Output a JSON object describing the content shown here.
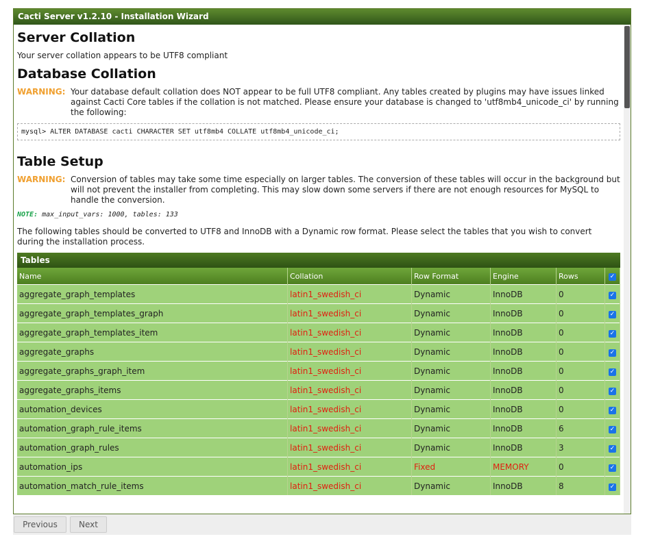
{
  "window": {
    "title": "Cacti Server v1.2.10 - Installation Wizard"
  },
  "server_collation": {
    "heading": "Server Collation",
    "text": "Your server collation appears to be UTF8 compliant"
  },
  "database_collation": {
    "heading": "Database Collation",
    "warning_label": "WARNING:",
    "warning_text": "Your database default collation does NOT appear to be full UTF8 compliant. Any tables created by plugins may have issues linked against Cacti Core tables if the collation is not matched. Please ensure your database is changed to 'utf8mb4_unicode_ci' by running the following:",
    "command": "mysql> ALTER DATABASE cacti CHARACTER SET utf8mb4 COLLATE utf8mb4_unicode_ci;"
  },
  "table_setup": {
    "heading": "Table Setup",
    "warning_label": "WARNING:",
    "warning_text": "Conversion of tables may take some time especially on larger tables. The conversion of these tables will occur in the background but will not prevent the installer from completing. This may slow down some servers if there are not enough resources for MySQL to handle the conversion.",
    "note_label": "NOTE:",
    "note_text": "max_input_vars: 1000, tables: 133",
    "description": "The following tables should be converted to UTF8 and InnoDB with a Dynamic row format. Please select the tables that you wish to convert during the installation process."
  },
  "tables": {
    "title": "Tables",
    "columns": [
      "Name",
      "Collation",
      "Row Format",
      "Engine",
      "Rows"
    ],
    "rows": [
      {
        "name": "aggregate_graph_templates",
        "collation": "latin1_swedish_ci",
        "row_format": "Dynamic",
        "engine": "InnoDB",
        "rows": "0"
      },
      {
        "name": "aggregate_graph_templates_graph",
        "collation": "latin1_swedish_ci",
        "row_format": "Dynamic",
        "engine": "InnoDB",
        "rows": "0"
      },
      {
        "name": "aggregate_graph_templates_item",
        "collation": "latin1_swedish_ci",
        "row_format": "Dynamic",
        "engine": "InnoDB",
        "rows": "0"
      },
      {
        "name": "aggregate_graphs",
        "collation": "latin1_swedish_ci",
        "row_format": "Dynamic",
        "engine": "InnoDB",
        "rows": "0"
      },
      {
        "name": "aggregate_graphs_graph_item",
        "collation": "latin1_swedish_ci",
        "row_format": "Dynamic",
        "engine": "InnoDB",
        "rows": "0"
      },
      {
        "name": "aggregate_graphs_items",
        "collation": "latin1_swedish_ci",
        "row_format": "Dynamic",
        "engine": "InnoDB",
        "rows": "0"
      },
      {
        "name": "automation_devices",
        "collation": "latin1_swedish_ci",
        "row_format": "Dynamic",
        "engine": "InnoDB",
        "rows": "0"
      },
      {
        "name": "automation_graph_rule_items",
        "collation": "latin1_swedish_ci",
        "row_format": "Dynamic",
        "engine": "InnoDB",
        "rows": "6"
      },
      {
        "name": "automation_graph_rules",
        "collation": "latin1_swedish_ci",
        "row_format": "Dynamic",
        "engine": "InnoDB",
        "rows": "3"
      },
      {
        "name": "automation_ips",
        "collation": "latin1_swedish_ci",
        "row_format": "Fixed",
        "engine": "MEMORY",
        "rows": "0"
      },
      {
        "name": "automation_match_rule_items",
        "collation": "latin1_swedish_ci",
        "row_format": "Dynamic",
        "engine": "InnoDB",
        "rows": "8"
      }
    ]
  },
  "buttons": {
    "previous": "Previous",
    "next": "Next"
  }
}
